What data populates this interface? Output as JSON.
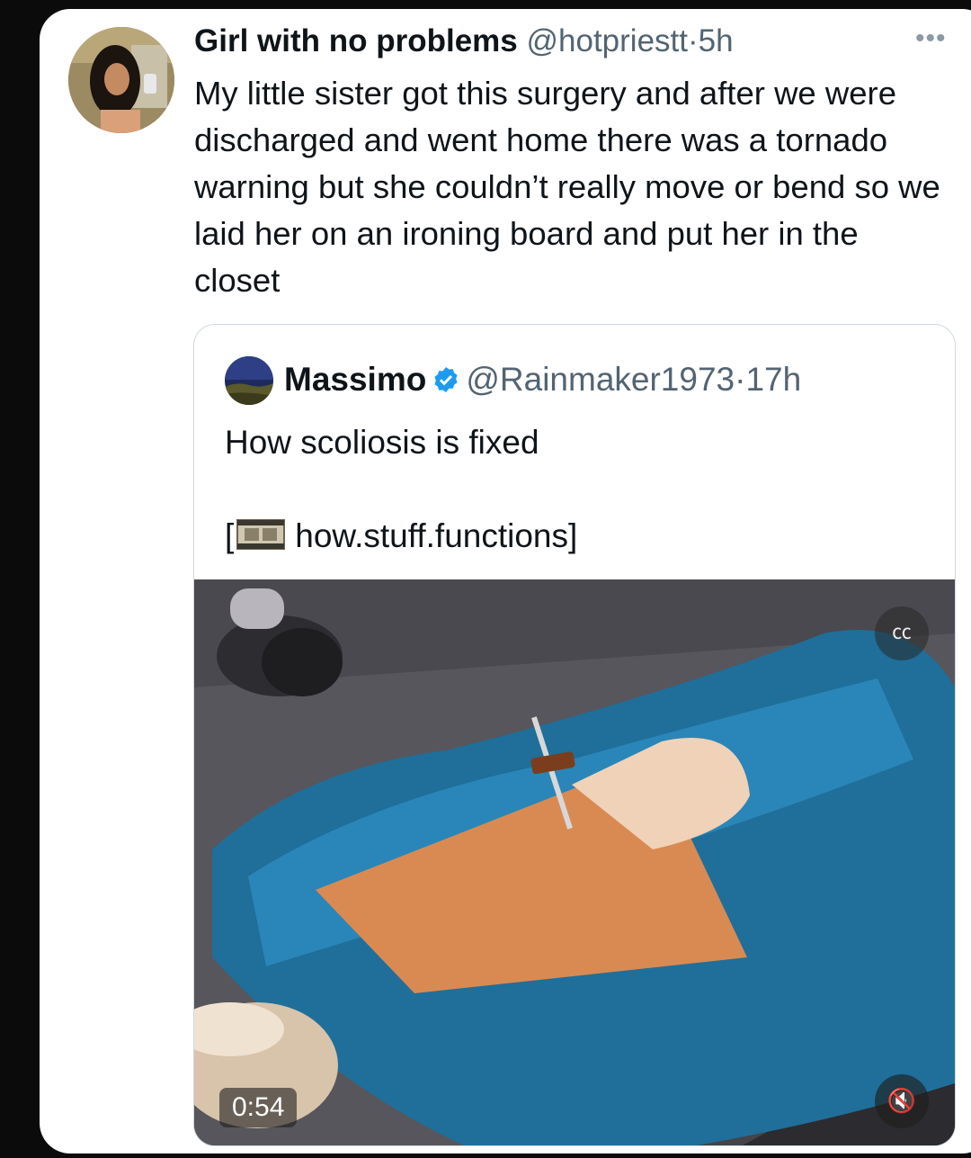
{
  "tweet": {
    "author_name": "Girl with no problems",
    "handle": "@hotpriestt",
    "separator": "·",
    "time": "5h",
    "more_icon": "ellipsis-icon",
    "text": "My little sister got this surgery and after we were discharged and went home there was a tornado warning but she couldn’t really move or bend so we laid her on an ironing board and put her in the closet"
  },
  "quote": {
    "author_name": "Massimo",
    "verified_icon": "verified-badge-icon",
    "handle": "@Rainmaker1973",
    "separator": "·",
    "time": "17h",
    "text": "How scoliosis is fixed",
    "link_open": "[",
    "link_icon": "film-strip-icon",
    "link_text": "how.stuff.functions]"
  },
  "video": {
    "duration": "0:54",
    "cc_icon": "captions-off-icon",
    "mute_icon": "muted-speaker-icon"
  },
  "colors": {
    "background": "#0b0b0b",
    "card": "#ffffff",
    "text": "#0f1419",
    "muted": "#536471",
    "verified": "#1d9bf0"
  }
}
